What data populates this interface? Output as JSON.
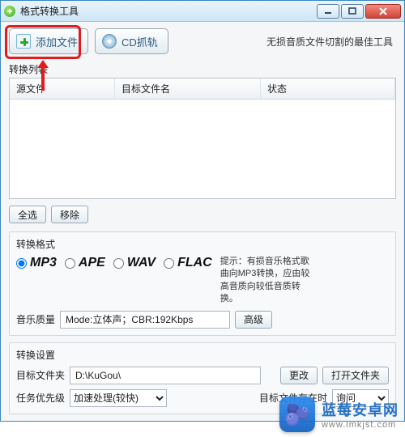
{
  "titlebar": {
    "title": "格式转换工具"
  },
  "toolbar": {
    "add_file_label": "添加文件",
    "cd_ripping_label": "CD抓轨",
    "tagline": "无损音质文件切割的最佳工具"
  },
  "list": {
    "section_label": "转换列表",
    "headers": {
      "source": "源文件",
      "target": "目标文件名",
      "status": "状态"
    }
  },
  "list_buttons": {
    "select_all": "全选",
    "remove": "移除"
  },
  "format_group": {
    "title": "转换格式",
    "options": {
      "mp3": "MP3",
      "ape": "APE",
      "wav": "WAV",
      "flac": "FLAC"
    },
    "selected": "mp3",
    "quality_label": "音乐质量",
    "quality_value": "Mode:立体声；CBR:192Kbps",
    "advanced": "高级",
    "hint_label": "提示：",
    "hint_text": "有损音乐格式歌曲向MP3转换，应由较高音质向较低音质转换。"
  },
  "settings_group": {
    "title": "转换设置",
    "target_folder_label": "目标文件夹",
    "target_folder_value": "D:\\KuGou\\",
    "change": "更改",
    "open_folder": "打开文件夹",
    "priority_label": "任务优先级",
    "priority_value": "加速处理(较快)",
    "on_exists_label": "目标文件存在时",
    "on_exists_value": "询问"
  },
  "watermark": {
    "line1": "蓝莓安卓网",
    "line2": "www.lmkjst.com",
    "emoji": "🫐"
  }
}
